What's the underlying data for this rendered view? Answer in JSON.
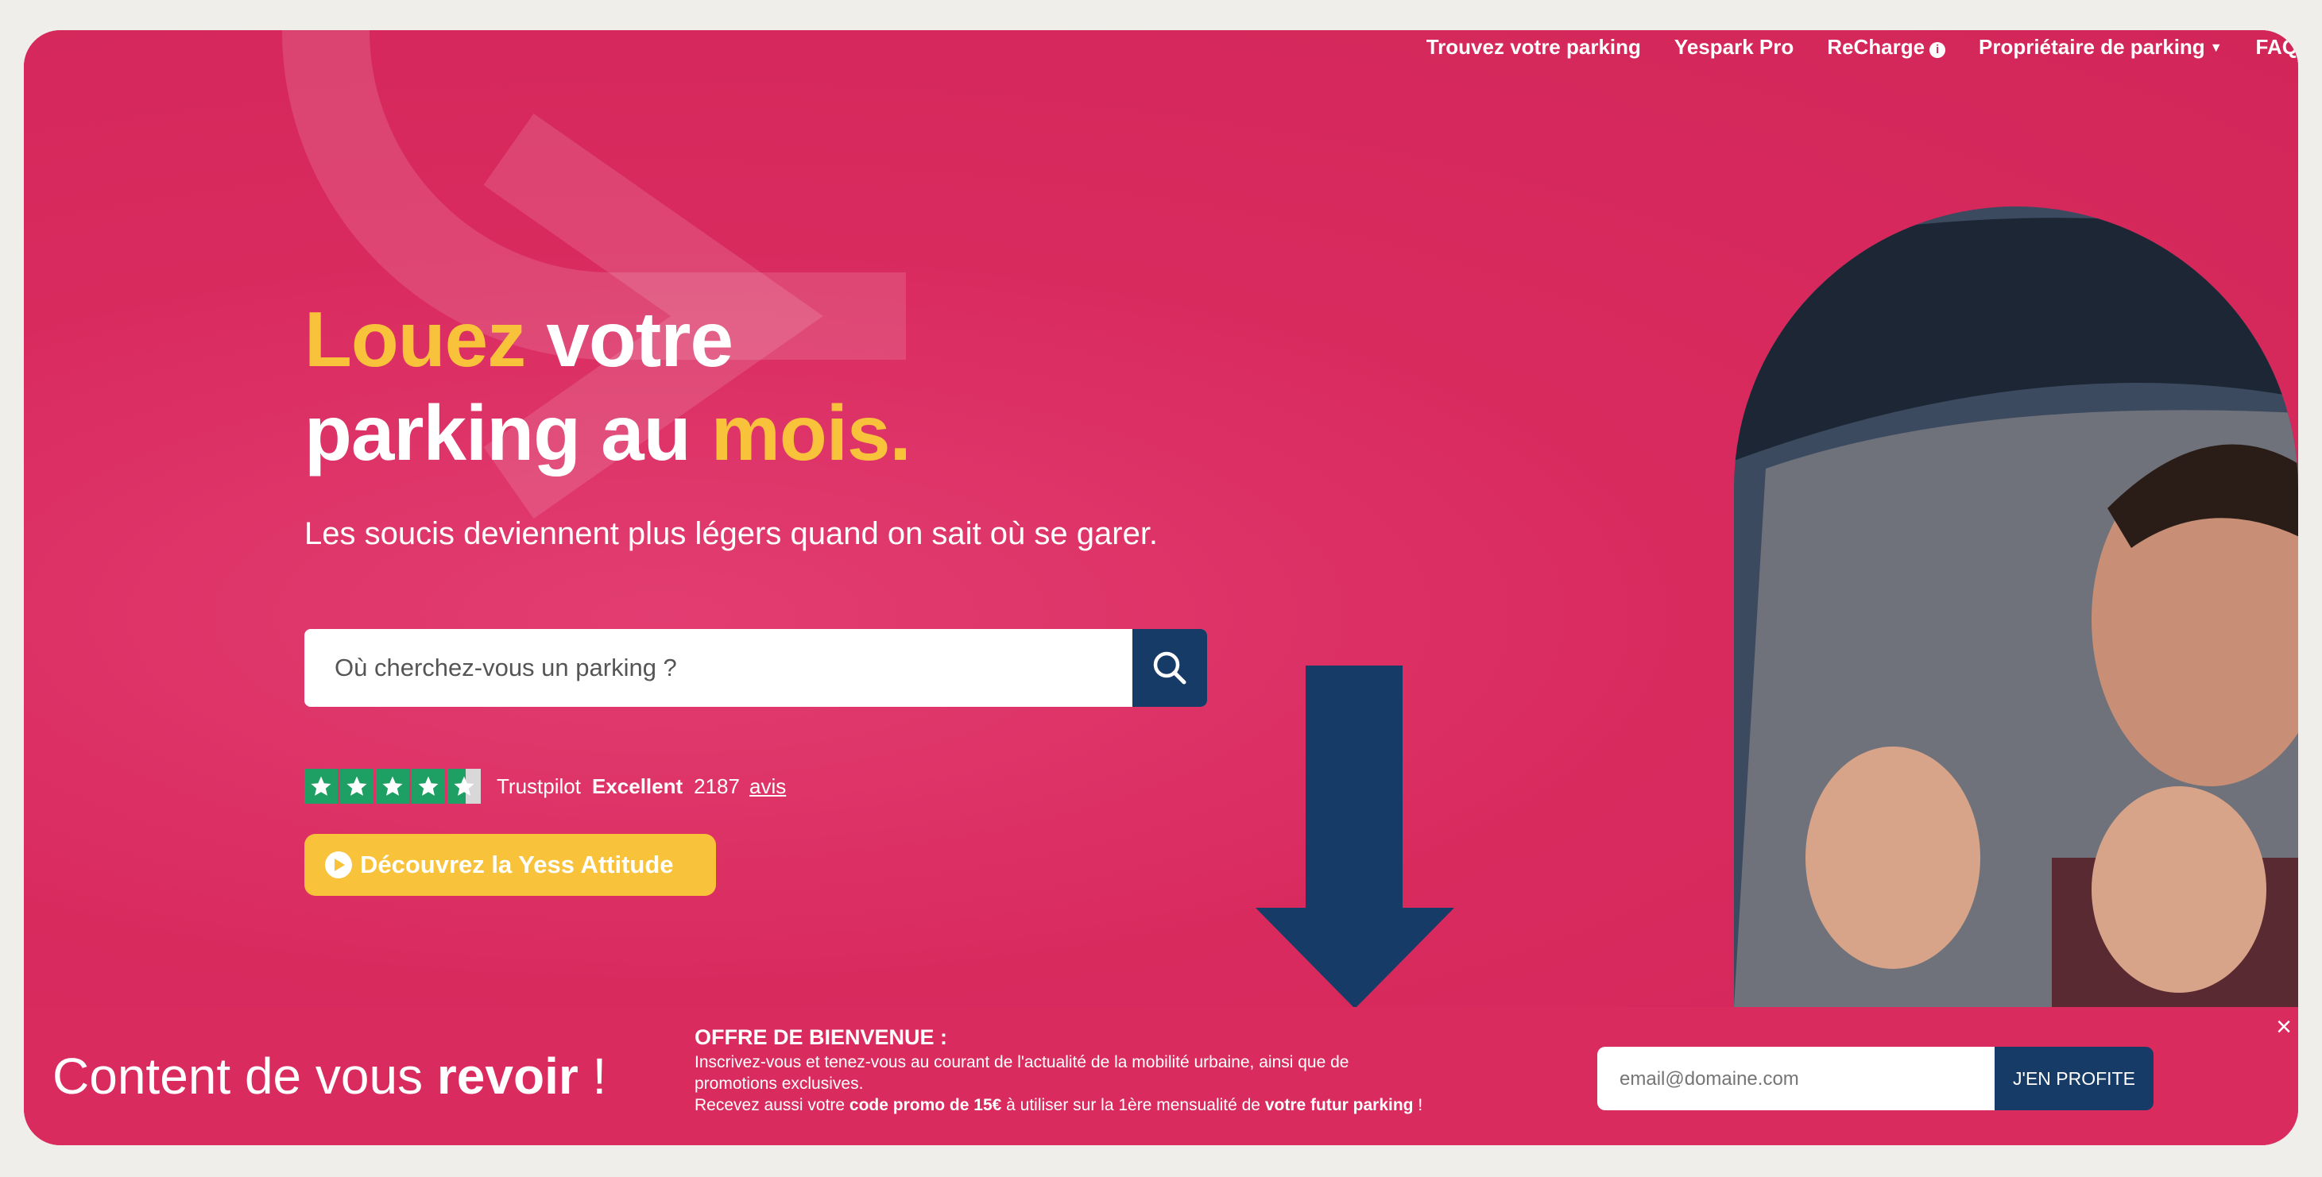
{
  "nav": {
    "items": [
      "Trouvez votre parking",
      "Yespark Pro",
      "ReCharge",
      "Propriétaire de parking",
      "FAQ"
    ]
  },
  "hero": {
    "headline_line1_a": "Louez",
    "headline_line1_b": " votre",
    "headline_line2_a": "parking au ",
    "headline_line2_b": "mois.",
    "subtitle": "Les soucis deviennent plus légers quand on sait où se garer.",
    "search_placeholder": "Où cherchez-vous un parking ?",
    "cta_label": "Découvrez la Yess Attitude"
  },
  "trustpilot": {
    "brand": "Trustpilot",
    "rating_text": "Excellent",
    "count": "2187",
    "reviews_link": "avis",
    "stars": 4.5
  },
  "banner": {
    "greeting": "Content de vous ",
    "greeting_bold": "revoir",
    "greeting_end": " !",
    "offer_title": "OFFRE DE BIENVENUE :",
    "offer_line1": "Inscrivez-vous et tenez-vous au courant de l'actualité de la mobilité urbaine, ainsi que de promotions exclusives.",
    "offer_line2_a": "Recevez aussi votre ",
    "offer_line2_b": "code promo de 15€",
    "offer_line2_c": " à utiliser sur la 1ère mensualité de ",
    "offer_line2_d": "votre futur parking",
    "offer_line2_e": " !",
    "email_placeholder": "email@domaine.com",
    "submit_label": "J'EN PROFITE",
    "close_symbol": "×"
  },
  "colors": {
    "brand_pink": "#d92a5e",
    "accent_yellow": "#f8c23b",
    "navy": "#163b67",
    "trustpilot_green": "#1e9f63"
  }
}
